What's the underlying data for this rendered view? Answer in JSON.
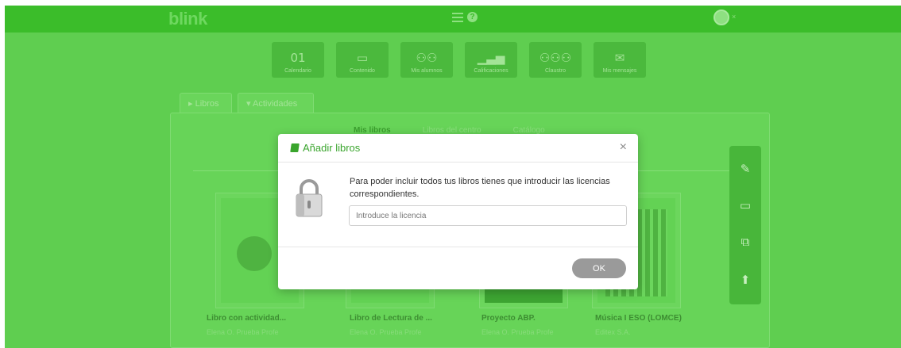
{
  "header": {
    "logo": "blink",
    "help": "?",
    "avatar_close": "×"
  },
  "modules": [
    {
      "label": "Calendario",
      "icon": "calendar-icon",
      "glyph": "01"
    },
    {
      "label": "Contenido",
      "icon": "screen-icon",
      "glyph": "▭"
    },
    {
      "label": "Mis alumnos",
      "icon": "students-icon",
      "glyph": "⚇⚇"
    },
    {
      "label": "Calificaciones",
      "icon": "bar-chart-icon",
      "glyph": "▁▃▅"
    },
    {
      "label": "Claustro",
      "icon": "staff-icon",
      "glyph": "⚇⚇⚇"
    },
    {
      "label": "Mis mensajes",
      "icon": "envelope-icon",
      "glyph": "✉"
    }
  ],
  "tabs": {
    "libros": "Libros",
    "actividades": "Actividades"
  },
  "subtabs": [
    "Mis libros",
    "Libros del centro",
    "Catálogo"
  ],
  "books": [
    {
      "title": "Libro con actividad...",
      "author": "Elena O. Prueba Profe"
    },
    {
      "title": "Libro de Lectura de ...",
      "author": "Elena O. Prueba Profe"
    },
    {
      "title": "Proyecto ABP.",
      "author": "Elena O. Prueba Profe"
    },
    {
      "title": "Música I ESO (LOMCE)",
      "author": "Editex S.A."
    }
  ],
  "modal": {
    "title": "Añadir libros",
    "close": "×",
    "message": "Para poder incluir todos tus libros tienes que introducir las licencias correspondientes.",
    "input_placeholder": "Introduce la licencia",
    "ok_label": "OK"
  },
  "colors": {
    "brand_green": "#3bbd2a",
    "modal_title": "#3aa52d",
    "ok_button": "#9a9a9a"
  }
}
